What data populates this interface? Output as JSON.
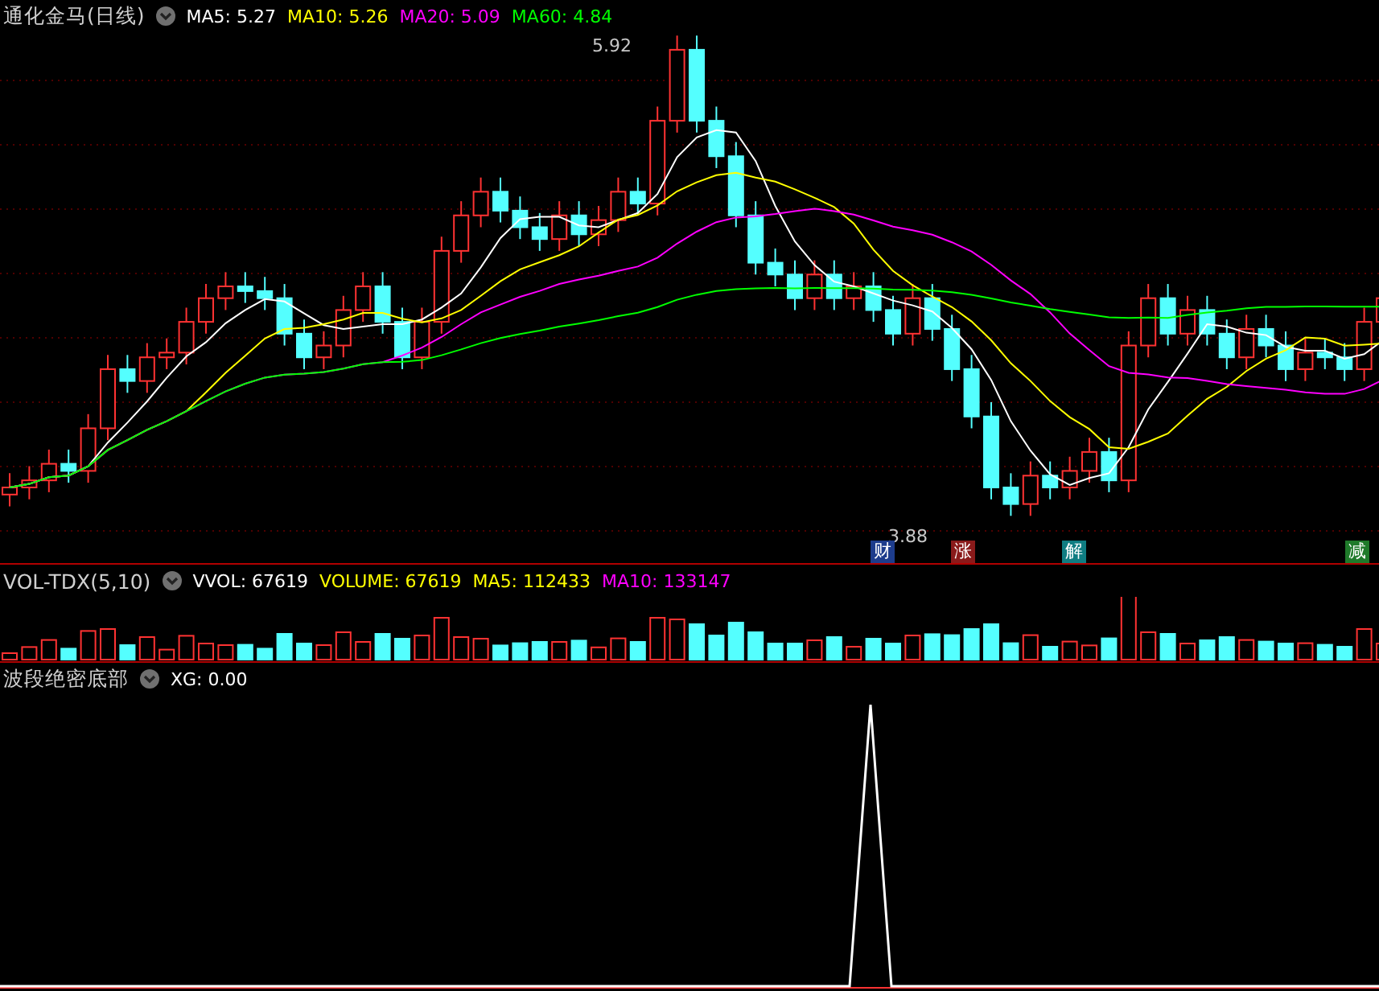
{
  "main_panel": {
    "title": "通化金马(日线)",
    "indicators": [
      {
        "label": "MA5: 5.27",
        "color": "#ffffff"
      },
      {
        "label": "MA10: 5.26",
        "color": "#ffff00"
      },
      {
        "label": "MA20: 5.09",
        "color": "#ff00ff"
      },
      {
        "label": "MA60: 4.84",
        "color": "#00ff00"
      }
    ],
    "high_label": "5.92",
    "low_label": "3.88",
    "badges": [
      {
        "text": "财",
        "color": "#1d3c8c"
      },
      {
        "text": "涨",
        "color": "#8a1a1a"
      },
      {
        "text": "解",
        "color": "#0f7d82"
      },
      {
        "text": "减",
        "color": "#1f7a2a"
      }
    ]
  },
  "volume_panel": {
    "title": "VOL-TDX(5,10)",
    "indicators": [
      {
        "label": "VVOL: 67619",
        "color": "#ffffff"
      },
      {
        "label": "VOLUME: 67619",
        "color": "#ffff00"
      },
      {
        "label": "MA5: 112433",
        "color": "#ffff00"
      },
      {
        "label": "MA10: 133147",
        "color": "#ff00ff"
      }
    ]
  },
  "signal_panel": {
    "title": "波段绝密底部",
    "indicators": [
      {
        "label": "XG: 0.00",
        "color": "#ffffff"
      }
    ]
  }
}
